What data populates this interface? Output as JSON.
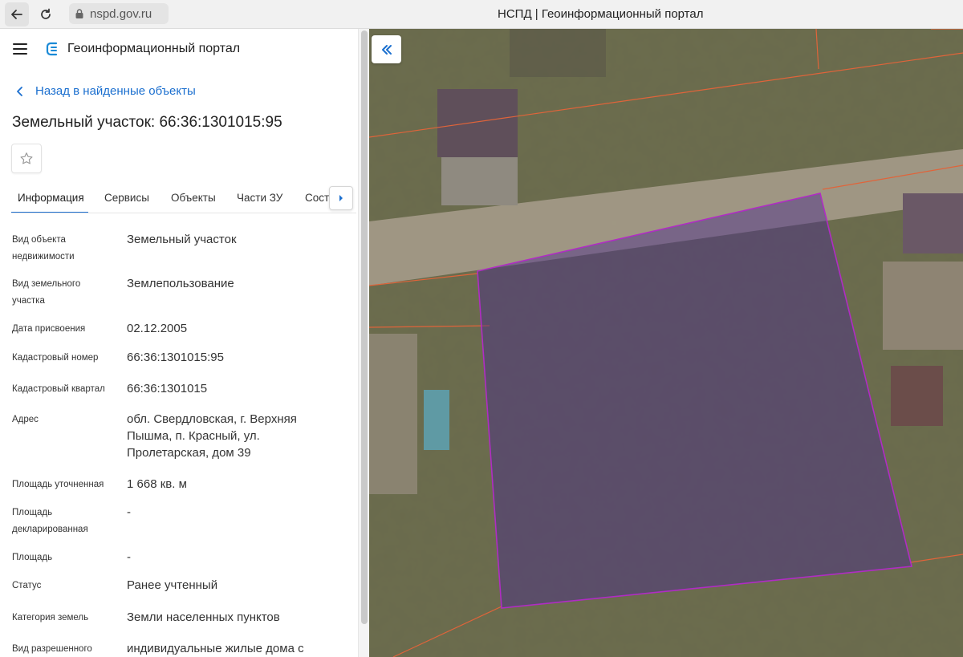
{
  "browser": {
    "url": "nspd.gov.ru",
    "tab_title": "НСПД | Геоинформационный портал"
  },
  "app": {
    "title": "Геоинформационный портал",
    "back_link": "Назад в найденные объекты",
    "object_title": "Земельный участок: 66:36:1301015:95"
  },
  "tabs": [
    {
      "label": "Информация",
      "active": true
    },
    {
      "label": "Сервисы",
      "active": false
    },
    {
      "label": "Объекты",
      "active": false
    },
    {
      "label": "Части ЗУ",
      "active": false
    },
    {
      "label": "Состав",
      "active": false
    }
  ],
  "properties": [
    {
      "label": "Вид объекта недвижимости",
      "value": "Земельный участок"
    },
    {
      "label": "Вид земельного участка",
      "value": "Землепользование"
    },
    {
      "label": "Дата присвоения",
      "value": "02.12.2005"
    },
    {
      "label": "Кадастровый номер",
      "value": "66:36:1301015:95"
    },
    {
      "label": "Кадастровый квартал",
      "value": "66:36:1301015"
    },
    {
      "label": "Адрес",
      "value": "обл. Свердловская, г. Верхняя Пышма, п. Красный, ул. Пролетарская, дом 39"
    },
    {
      "label": "Площадь уточненная",
      "value": "1 668 кв. м"
    },
    {
      "label": "Площадь декларированная",
      "value": "-"
    },
    {
      "label": "Площадь",
      "value": "-"
    },
    {
      "label": "Статус",
      "value": "Ранее учтенный"
    },
    {
      "label": "Категория земель",
      "value": "Земли населенных пунктов"
    },
    {
      "label": "Вид разрешенного",
      "value": "индивидуальные жилые дома с"
    }
  ],
  "icons": {
    "back": "arrow-left-icon",
    "reload": "reload-icon",
    "lock": "lock-icon",
    "menu": "hamburger-icon",
    "logo": "portal-logo-icon",
    "favorite": "star-icon",
    "tabs_next": "chevron-right-icon",
    "collapse": "double-chevron-left-icon"
  },
  "colors": {
    "accent": "#1b6fcf",
    "parcel_outline": "#b02cc4",
    "parcel_fill": "#4a2a8c",
    "cadastre_lines": "#e0643a"
  }
}
